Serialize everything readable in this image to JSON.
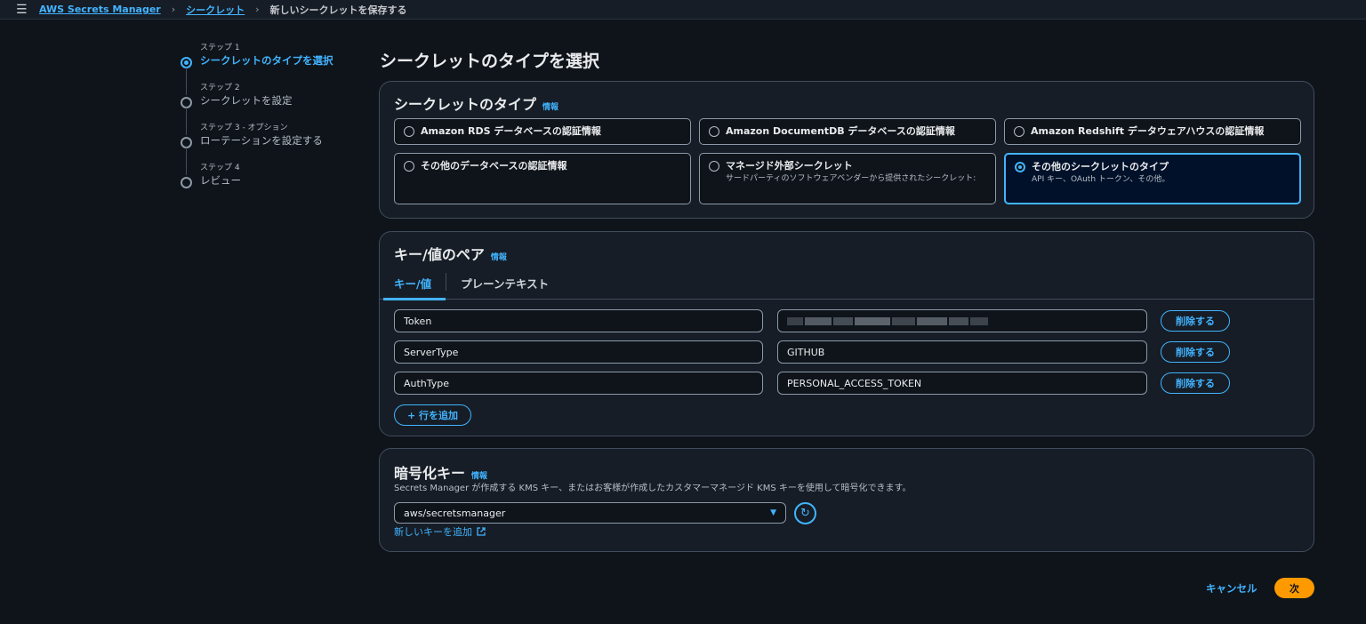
{
  "breadcrumb": {
    "service": "AWS Secrets Manager",
    "secrets": "シークレット",
    "current": "新しいシークレットを保存する"
  },
  "steps": [
    {
      "num": "ステップ 1",
      "title": "シークレットのタイプを選択"
    },
    {
      "num": "ステップ 2",
      "title": "シークレットを設定"
    },
    {
      "num": "ステップ 3 - オプション",
      "title": "ローテーションを設定する"
    },
    {
      "num": "ステップ 4",
      "title": "レビュー"
    }
  ],
  "page_title": "シークレットのタイプを選択",
  "info_label": "情報",
  "secret_type": {
    "title": "シークレットのタイプ",
    "options": [
      {
        "label": "Amazon RDS データベースの認証情報",
        "desc": ""
      },
      {
        "label": "Amazon DocumentDB データベースの認証情報",
        "desc": ""
      },
      {
        "label": "Amazon Redshift データウェアハウスの認証情報",
        "desc": ""
      },
      {
        "label": "その他のデータベースの認証情報",
        "desc": ""
      },
      {
        "label": "マネージド外部シークレット",
        "desc": "サードパーティのソフトウェアベンダーから提供されたシークレット:"
      },
      {
        "label": "その他のシークレットのタイプ",
        "desc": "API キー、OAuth トークン、その他。"
      }
    ],
    "selected_index": 5
  },
  "kv": {
    "title": "キー/値のペア",
    "tabs": [
      "キー/値",
      "プレーンテキスト"
    ],
    "rows": [
      {
        "key": "Token",
        "value": ""
      },
      {
        "key": "ServerType",
        "value": "GITHUB"
      },
      {
        "key": "AuthType",
        "value": "PERSONAL_ACCESS_TOKEN"
      }
    ],
    "delete_label": "削除する",
    "add_row_label": "+ 行を追加"
  },
  "encryption": {
    "title": "暗号化キー",
    "description": "Secrets Manager が作成する KMS キー、またはお客様が作成したカスタマーマネージド KMS キーを使用して暗号化できます。",
    "selected_key": "aws/secretsmanager",
    "add_key_link": "新しいキーを追加"
  },
  "footer": {
    "cancel": "キャンセル",
    "next": "次"
  },
  "colors": {
    "accent": "#42b4ff",
    "primary_button": "#ff9900",
    "background": "#0f141a",
    "panel": "#161d26"
  }
}
